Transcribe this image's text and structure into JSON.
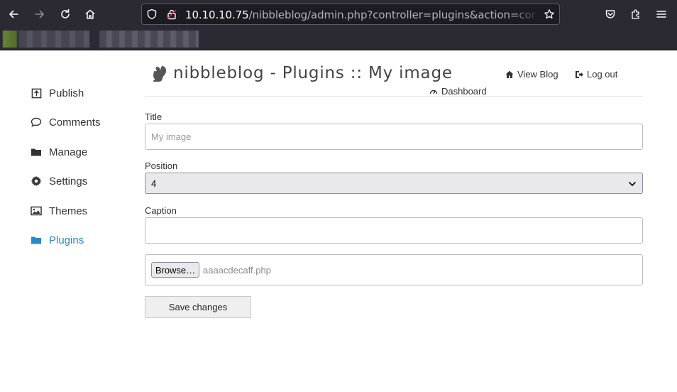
{
  "browser": {
    "url_host": "10.10.10.75",
    "url_path": "/nibbleblog/admin.php?controller=plugins&action=config&pl"
  },
  "sidebar": {
    "items": [
      {
        "label": "Publish",
        "icon": "publish-icon"
      },
      {
        "label": "Comments",
        "icon": "comment-icon"
      },
      {
        "label": "Manage",
        "icon": "folder-icon"
      },
      {
        "label": "Settings",
        "icon": "gear-icon"
      },
      {
        "label": "Themes",
        "icon": "image-icon"
      },
      {
        "label": "Plugins",
        "icon": "folder-open-icon",
        "active": true
      }
    ],
    "active_color": "#2a87c8"
  },
  "header": {
    "title": "nibbleblog - Plugins :: My image",
    "view_blog": "View Blog",
    "log_out": "Log out",
    "dashboard": "Dashboard"
  },
  "form": {
    "title_label": "Title",
    "title_value": "My image",
    "position_label": "Position",
    "position_value": "4",
    "caption_label": "Caption",
    "caption_value": "",
    "browse_label": "Browse…",
    "file_name": "aaaacdecaff.php",
    "save_label": "Save changes"
  }
}
